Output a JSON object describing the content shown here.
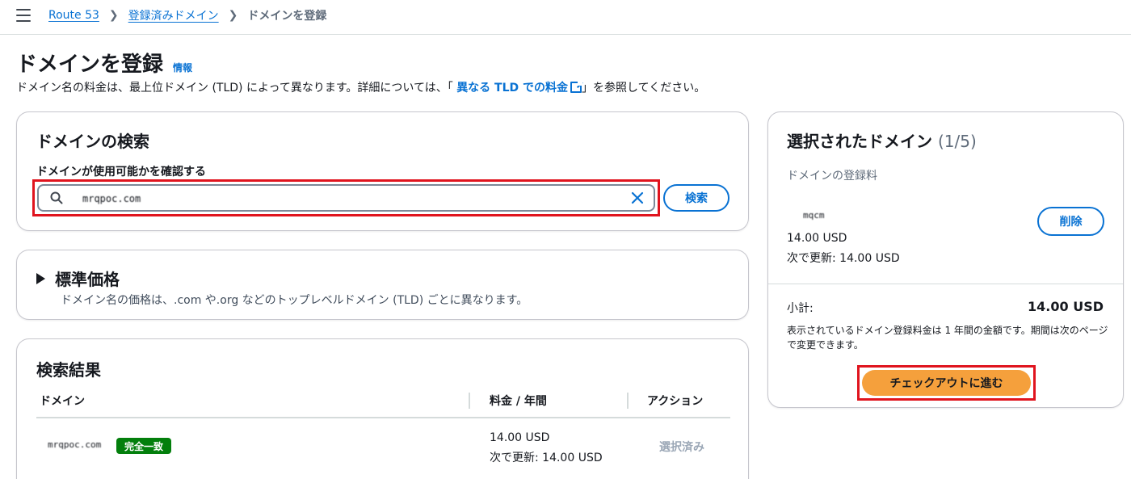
{
  "breadcrumb": {
    "items": [
      "Route 53",
      "登録済みドメイン"
    ],
    "current": "ドメインを登録"
  },
  "header": {
    "title": "ドメインを登録",
    "info_link": "情報",
    "desc_prefix": "ドメイン名の料金は、最上位ドメイン (TLD) によって異なります。詳細については、「 ",
    "desc_link": "異なる TLD での料金",
    "desc_suffix": "」を参照してください。"
  },
  "search": {
    "title": "ドメインの検索",
    "field_label": "ドメインが使用可能かを確認する",
    "input_value": "mrqpoc.com",
    "button_label": "検索"
  },
  "pricing": {
    "title": "標準価格",
    "description": "ドメイン名の価格は、.com や.org などのトップレベルドメイン (TLD) ごとに異なります。"
  },
  "results": {
    "title": "検索結果",
    "columns": [
      "ドメイン",
      "料金 / 年間",
      "アクション"
    ],
    "rows": [
      {
        "domain": "mrqpoc.com",
        "badge": "完全一致",
        "price": "14.00 USD",
        "renewal": "次で更新: 14.00 USD",
        "action": "選択済み"
      }
    ]
  },
  "selected": {
    "title": "選択されたドメイン",
    "count": "(1/5)",
    "fee_label": "ドメインの登録料",
    "domain": "mqcm",
    "price": "14.00 USD",
    "renewal": "次で更新: 14.00 USD",
    "delete_label": "削除",
    "subtotal_label": "小計:",
    "subtotal_value": "14.00 USD",
    "note": "表示されているドメイン登録料金は 1 年間の金額です。期間は次のページで変更できます。",
    "checkout_label": "チェックアウトに進む"
  },
  "colors": {
    "link": "#0972d3",
    "highlight_border": "#e0141e",
    "badge_green": "#037f0c",
    "checkout_orange": "#f5a03c"
  },
  "icons": {
    "menu": "hamburger-menu-icon",
    "separator": "chevron-right-icon",
    "search": "search-icon",
    "clear": "close-icon",
    "external": "external-link-icon",
    "expand": "caret-right-icon"
  }
}
